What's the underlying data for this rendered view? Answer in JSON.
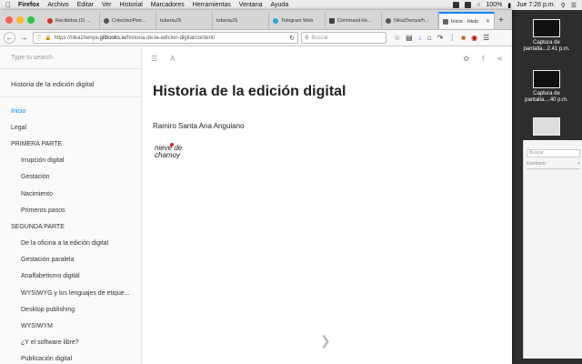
{
  "menubar": {
    "app": "Firefox",
    "items": [
      "Archivo",
      "Editar",
      "Ver",
      "Historial",
      "Marcadores",
      "Herramientas",
      "Ventana",
      "Ayuda"
    ],
    "battery": "100%",
    "clock": "Jue 7:26 p.m."
  },
  "tabs": [
    {
      "label": "Recibidos (2) ...",
      "icon": "gmail-icon"
    },
    {
      "label": "ColectivoPerr...",
      "icon": "github-icon"
    },
    {
      "label": "tuberiaJS",
      "icon": "page-icon"
    },
    {
      "label": "tuberiaJS",
      "icon": "page-icon"
    },
    {
      "label": "Telegram Web",
      "icon": "telegram-icon"
    },
    {
      "label": "Command-lin...",
      "icon": "page-icon"
    },
    {
      "label": "NikaZhenya/h...",
      "icon": "github-icon"
    },
    {
      "label": "Inicio · Histo",
      "icon": "page-icon",
      "active": true
    }
  ],
  "navbar": {
    "url_prefix": "https://nikazhenya.",
    "url_domain": "gitbooks.io",
    "url_path": "/historia-de-la-edicion-digital/content/",
    "search_placeholder": "Buscar"
  },
  "sidebar": {
    "search_placeholder": "Type to search",
    "book_title": "Historia de la edición digital",
    "items": [
      {
        "label": "Inicio",
        "active": true
      },
      {
        "label": "Legal"
      },
      {
        "label": "PRIMERA PARTE"
      },
      {
        "label": "Irrupción digital",
        "sub": true
      },
      {
        "label": "Gestación",
        "sub": true
      },
      {
        "label": "Nacimiento",
        "sub": true
      },
      {
        "label": "Primeros pasos",
        "sub": true
      },
      {
        "label": "SEGUNDA PARTE"
      },
      {
        "label": "De la oficina a la edición digital",
        "sub": true
      },
      {
        "label": "Gestación paralela",
        "sub": true
      },
      {
        "label": "Analfabetismo digital",
        "sub": true
      },
      {
        "label": "WYSIWYG y los lenguajes de etique...",
        "sub": true
      },
      {
        "label": "Desktop publishing",
        "sub": true
      },
      {
        "label": "WYSIWYM",
        "sub": true
      },
      {
        "label": "¿Y el software libre?",
        "sub": true
      },
      {
        "label": "Publicación digital",
        "sub": true
      }
    ]
  },
  "article": {
    "title": "Historia de la edición digital",
    "author": "Ramiro Santa Ana Anguiano",
    "logo_line1": "nieve de",
    "logo_line2": "chamoy"
  },
  "desktop": {
    "files": [
      {
        "label1": "Captura de",
        "label2": "pantalla...2.41 p.m."
      },
      {
        "label1": "Captura de",
        "label2": "pantalla....40 p.m."
      }
    ],
    "ghost_search": "Buscar",
    "ghost_folder": "Escritorio"
  }
}
